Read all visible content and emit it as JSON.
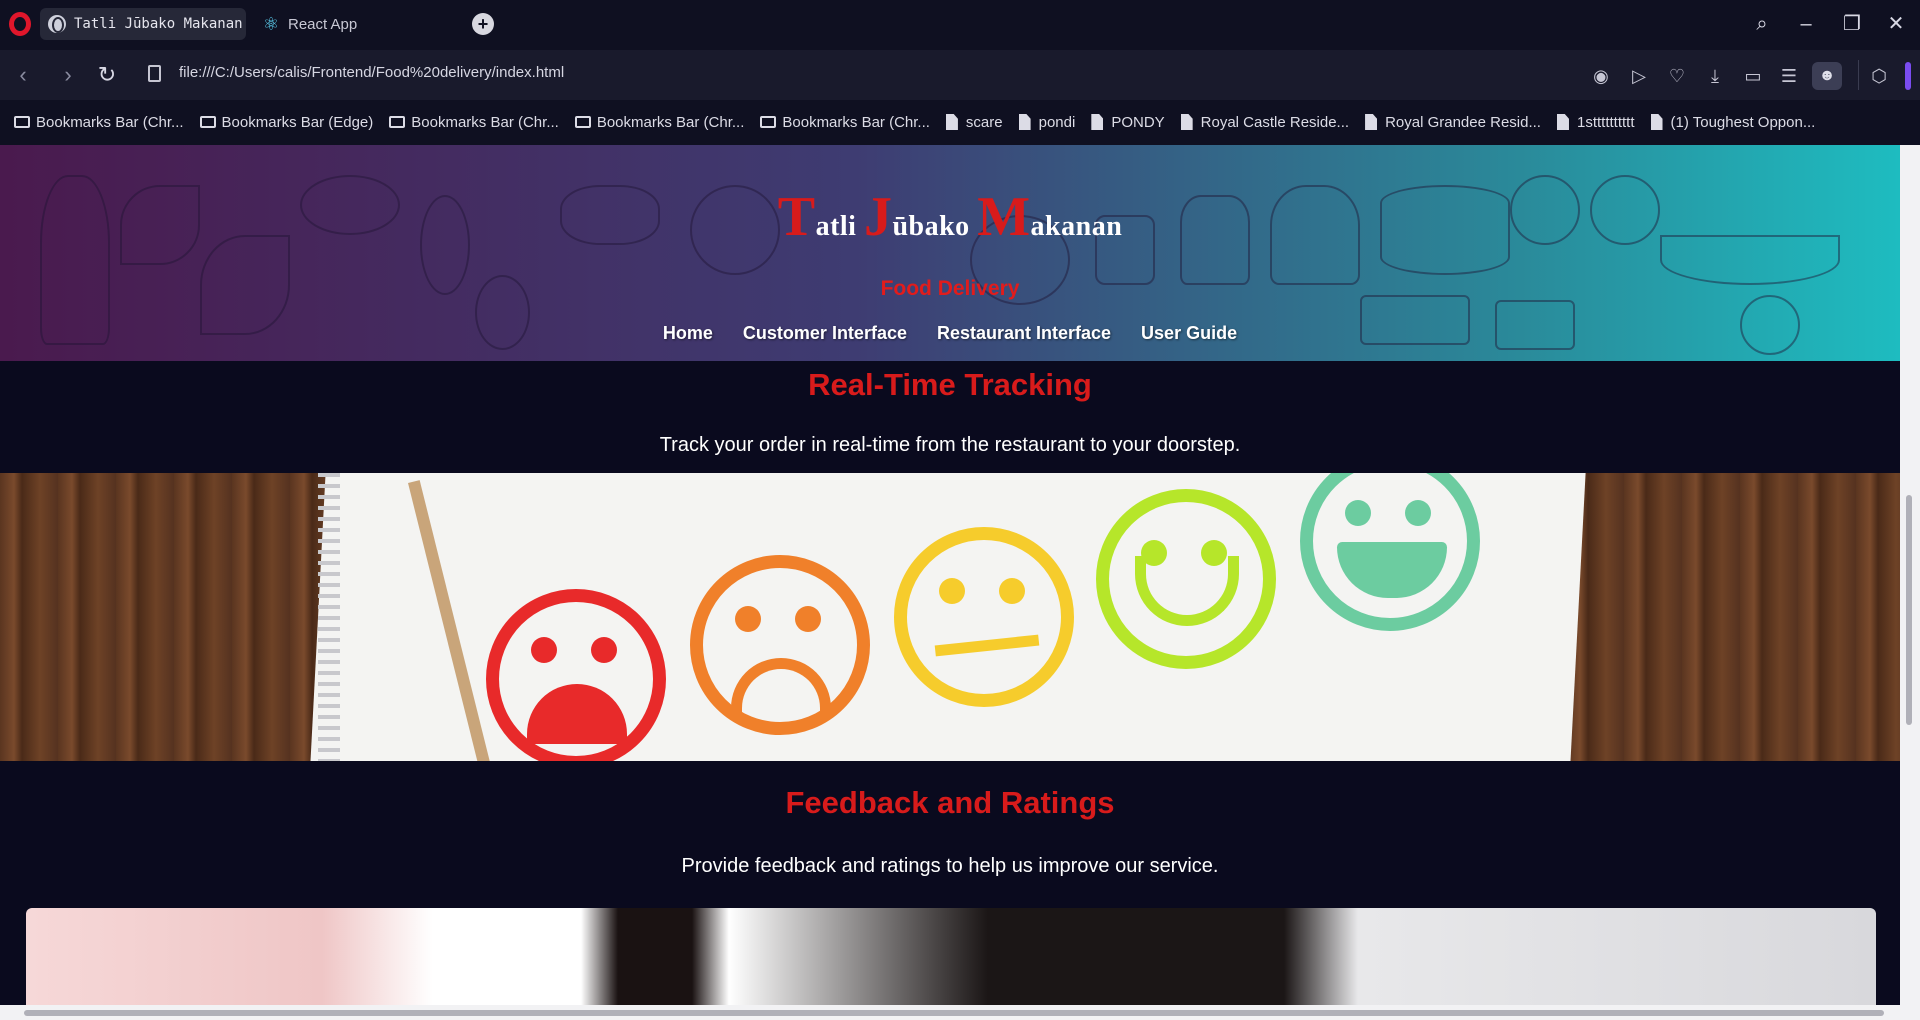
{
  "browser": {
    "tabs": [
      {
        "label": "Tatli Jūbako Makanan D",
        "active": true,
        "icon": "globe-icon"
      },
      {
        "label": "React App",
        "active": false,
        "icon": "react-icon"
      }
    ],
    "url": "file:///C:/Users/calis/Frontend/Food%20delivery/index.html",
    "bookmarks": [
      {
        "label": "Bookmarks Bar (Chr...",
        "type": "folder"
      },
      {
        "label": "Bookmarks Bar (Edge)",
        "type": "folder"
      },
      {
        "label": "Bookmarks Bar (Chr...",
        "type": "folder"
      },
      {
        "label": "Bookmarks Bar (Chr...",
        "type": "folder"
      },
      {
        "label": "Bookmarks Bar (Chr...",
        "type": "folder"
      },
      {
        "label": "scare",
        "type": "page"
      },
      {
        "label": "pondi",
        "type": "page"
      },
      {
        "label": "PONDY",
        "type": "page"
      },
      {
        "label": "Royal Castle Reside...",
        "type": "page"
      },
      {
        "label": "Royal Grandee Resid...",
        "type": "page"
      },
      {
        "label": "1stttttttttt",
        "type": "page"
      },
      {
        "label": "(1) Toughest Oppon...",
        "type": "page"
      }
    ]
  },
  "site": {
    "title": {
      "w1_cap": "T",
      "w1_rest": "atli ",
      "w2_cap": "J",
      "w2_rest": "ūbako ",
      "w3_cap": "M",
      "w3_rest": "akanan"
    },
    "subtitle": "Food Delivery",
    "nav": [
      "Home",
      "Customer Interface",
      "Restaurant Interface",
      "User Guide"
    ]
  },
  "sections": [
    {
      "title": "Real-Time Tracking",
      "text": "Track your order in real-time from the restaurant to your doorstep."
    },
    {
      "title": "Feedback and Ratings",
      "text": "Provide feedback and ratings to help us improve our service."
    }
  ],
  "colors": {
    "accent_red": "#d81b1b",
    "page_bg": "#0a0a1e",
    "face_colors": [
      "#e82a2a",
      "#f0802a",
      "#f6cc2c",
      "#b6e62a",
      "#6ccca0"
    ]
  }
}
